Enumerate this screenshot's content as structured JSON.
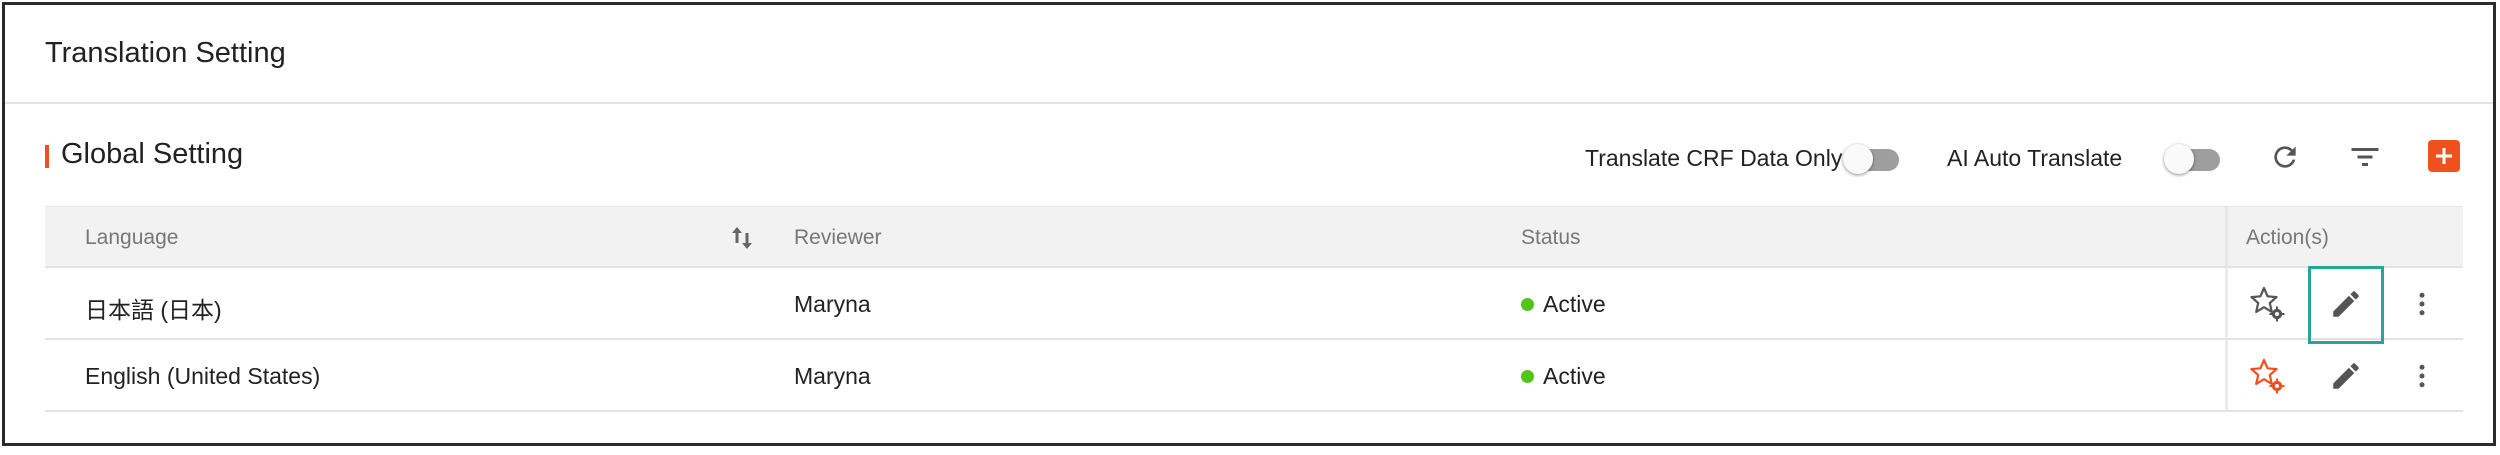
{
  "page": {
    "title": "Translation Setting"
  },
  "section": {
    "title": "Global Setting"
  },
  "toolbar": {
    "crf_only_label": "Translate CRF Data Only",
    "crf_only_enabled": false,
    "ai_auto_label": "AI Auto Translate",
    "ai_auto_enabled": false,
    "icons": [
      "refresh-icon",
      "filter-icon",
      "add-icon"
    ]
  },
  "table": {
    "columns": {
      "language": "Language",
      "reviewer": "Reviewer",
      "status": "Status",
      "actions": "Action(s)"
    },
    "rows": [
      {
        "language": "日本語 (日本)",
        "reviewer": "Maryna",
        "status": "Active",
        "default": false
      },
      {
        "language": "English (United States)",
        "reviewer": "Maryna",
        "status": "Active",
        "default": true
      }
    ]
  },
  "colors": {
    "accent": "#f0501e",
    "active": "#52c41a",
    "highlight": "#26a69a",
    "toggle_off": "#9e9e9e"
  }
}
